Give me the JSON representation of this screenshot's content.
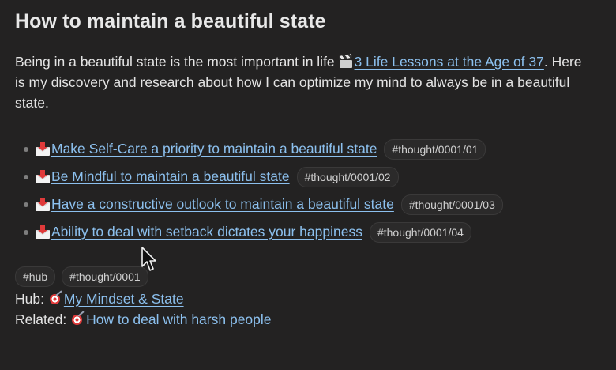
{
  "title": "How to maintain a beautiful state",
  "intro": {
    "text_before": "Being in a beautiful state is the most important in life",
    "link_icon": "clapper-board-icon",
    "link_text": "3 Life Lessons at the Age of 37",
    "text_after": ". Here is my discovery and research about how I can optimize my mind to always be in a beautiful state."
  },
  "items": [
    {
      "icon": "incoming-envelope-icon",
      "link": "Make Self-Care a priority to maintain a beautiful state",
      "tag": "#thought/0001/01"
    },
    {
      "icon": "incoming-envelope-icon",
      "link": "Be Mindful to maintain a beautiful state",
      "tag": "#thought/0001/02"
    },
    {
      "icon": "incoming-envelope-icon",
      "link": "Have a constructive outlook to maintain a beautiful state",
      "tag": "#thought/0001/03"
    },
    {
      "icon": "incoming-envelope-icon",
      "link": "Ability to deal with setback dictates your happiness",
      "tag": "#thought/0001/04"
    }
  ],
  "tags": [
    "#hub",
    "#thought/0001"
  ],
  "hub": {
    "label": "Hub:",
    "icon": "target-icon",
    "link": "My Mindset & State"
  },
  "related": {
    "label": "Related:",
    "icon": "target-icon",
    "link": "How to deal with harsh people"
  },
  "colors": {
    "background": "#232222",
    "link": "#8cc0ee",
    "text": "#e4e4e4"
  }
}
